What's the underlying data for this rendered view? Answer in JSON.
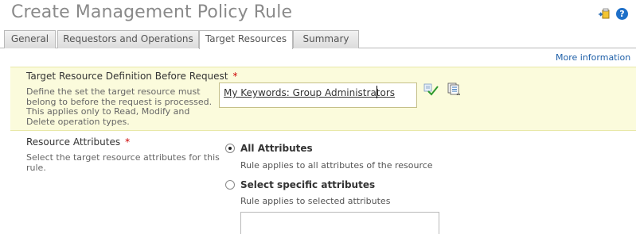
{
  "header": {
    "title": "Create Management Policy Rule",
    "help_label": "?"
  },
  "tabs": [
    {
      "label": "General",
      "active": false
    },
    {
      "label": "Requestors and Operations",
      "active": false
    },
    {
      "label": "Target Resources",
      "active": true
    },
    {
      "label": "Summary",
      "active": false
    }
  ],
  "links": {
    "more_information": "More information"
  },
  "target_before": {
    "label": "Target Resource Definition Before Request",
    "required_mark": "*",
    "description": [
      "Define the set the target resource must",
      "belong to before the request is processed.",
      "This applies only to Read, Modify and",
      "Delete operation types."
    ],
    "value": "My Keywords: Group Administrators"
  },
  "resource_attributes": {
    "label": "Resource Attributes",
    "required_mark": "*",
    "description": [
      "Select the target resource attributes for this",
      "rule."
    ],
    "options": [
      {
        "label": "All Attributes",
        "description": "Rule applies to all attributes of the resource",
        "selected": true
      },
      {
        "label": "Select specific attributes",
        "description": "Rule applies to selected attributes",
        "selected": false
      }
    ]
  },
  "colors": {
    "section_highlight": "#fbfbdc",
    "link": "#1e5fa8",
    "required": "#cc0000",
    "help_icon": "#1e6fc8"
  },
  "icons": [
    "pin-icon",
    "help-icon",
    "checkmark-icon",
    "browse-icon"
  ]
}
